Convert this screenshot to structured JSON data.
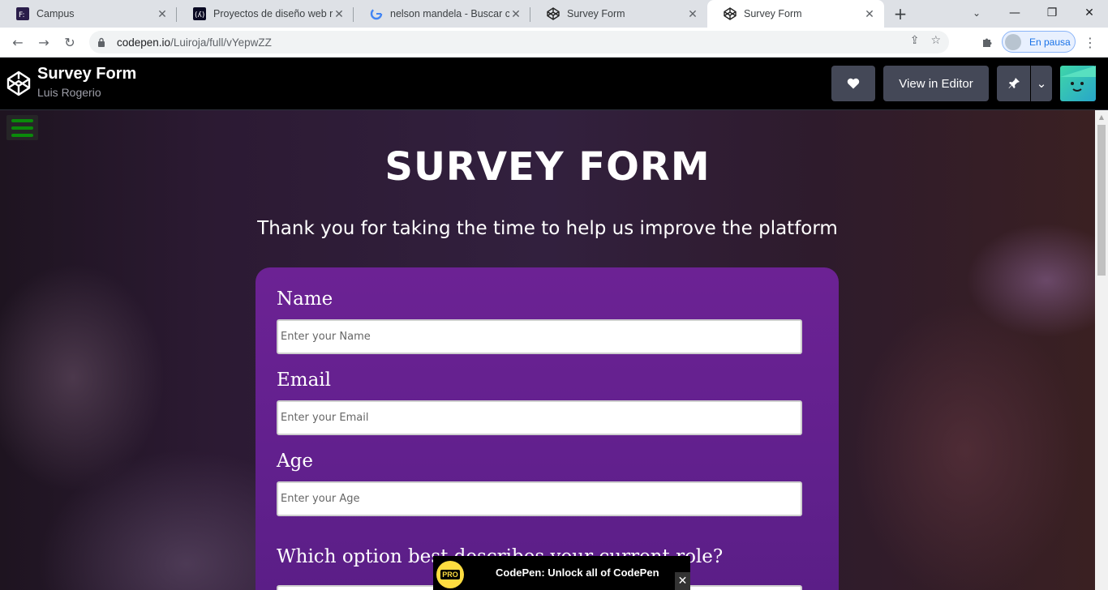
{
  "browser": {
    "tabs": [
      {
        "title": "Campus",
        "favicon": "campus-icon",
        "active": false
      },
      {
        "title": "Proyectos de diseño web resp",
        "favicon": "freecodecamp-icon",
        "active": false
      },
      {
        "title": "nelson mandela - Buscar con",
        "favicon": "google-icon",
        "active": false
      },
      {
        "title": "Survey Form",
        "favicon": "codepen-icon",
        "active": false
      },
      {
        "title": "Survey Form",
        "favicon": "codepen-icon",
        "active": true
      }
    ],
    "url_host": "codepen.io",
    "url_path": "/Luiroja/full/vYepwZZ",
    "profile_label": "En pausa"
  },
  "codepen": {
    "pen_title": "Survey Form",
    "author": "Luis Rogerio",
    "view_in_editor_label": "View in Editor"
  },
  "survey": {
    "heading": "SURVEY FORM",
    "description": "Thank you for taking the time to help us improve the platform",
    "fields": [
      {
        "label": "Name",
        "placeholder": "Enter your Name"
      },
      {
        "label": "Email",
        "placeholder": "Enter your Email"
      },
      {
        "label": "Age",
        "placeholder": "Enter your Age"
      }
    ],
    "role_question": "Which option best describes your current role?"
  },
  "promo": {
    "badge": "PRO",
    "text": "CodePen: Unlock all of CodePen"
  },
  "colors": {
    "form_bg": "#6c2294",
    "hamburger": "#0a8a0a",
    "codepen_button": "#444857",
    "promo_badge": "#ffdd40"
  }
}
